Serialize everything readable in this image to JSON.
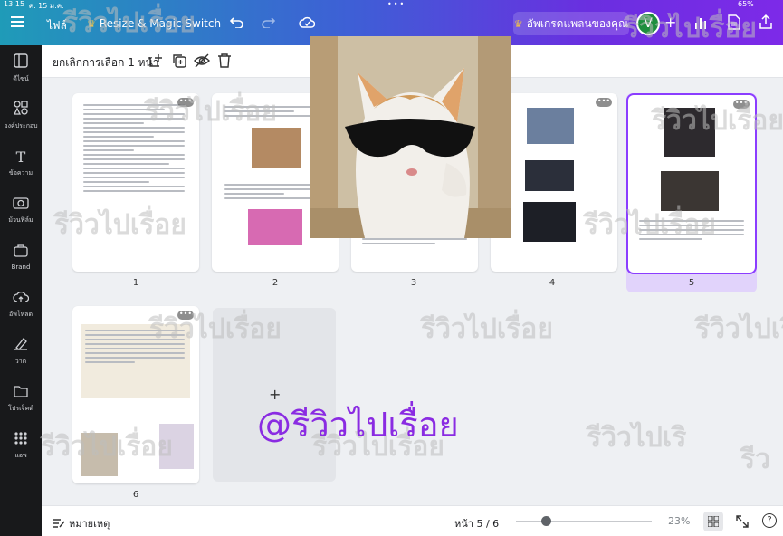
{
  "status": {
    "time": "13:15",
    "date": "ศ. 15 ม.ค.",
    "battery": "65%"
  },
  "topbar": {
    "file_label": "ไฟล์",
    "resize_label": "Resize & Magic Switch",
    "upgrade_label": "อัพเกรดแพลนของคุณ",
    "avatar_initial": "V",
    "add_symbol": "+"
  },
  "sidebar": {
    "items": [
      {
        "label": "ดีไซน์",
        "icon": "layout-icon"
      },
      {
        "label": "องค์ประกอบ",
        "icon": "elements-icon"
      },
      {
        "label": "ข้อความ",
        "icon": "text-icon"
      },
      {
        "label": "ม้วนฟิล์ม",
        "icon": "camera-icon"
      },
      {
        "label": "Brand",
        "icon": "brand-icon"
      },
      {
        "label": "อัพโหลด",
        "icon": "upload-icon"
      },
      {
        "label": "วาด",
        "icon": "draw-icon"
      },
      {
        "label": "โปรเจ็คต์",
        "icon": "folder-icon"
      },
      {
        "label": "แอพ",
        "icon": "apps-icon"
      }
    ]
  },
  "toolbar": {
    "deselect_label": "ยกเลิกการเลือก 1 หน้า"
  },
  "pages": [
    {
      "number": "1"
    },
    {
      "number": "2"
    },
    {
      "number": "3"
    },
    {
      "number": "4"
    },
    {
      "number": "5"
    },
    {
      "number": "6"
    }
  ],
  "overlay": {
    "watermark_main": "@รีวิวไปเรื่อย",
    "watermark_faded": "รีวิวไปเรื่อย",
    "watermark_partial": "รีวิวไปเริ",
    "watermark_edge": "รีว"
  },
  "bottombar": {
    "notes_label": "หมายเหตุ",
    "page_indicator": "หน้า 5 / 6",
    "zoom": "23%",
    "help_symbol": "?"
  },
  "colors": {
    "accent": "#8b3dff",
    "selected_page_border": "#8b3dff",
    "sidebar_bg": "#18191b"
  }
}
